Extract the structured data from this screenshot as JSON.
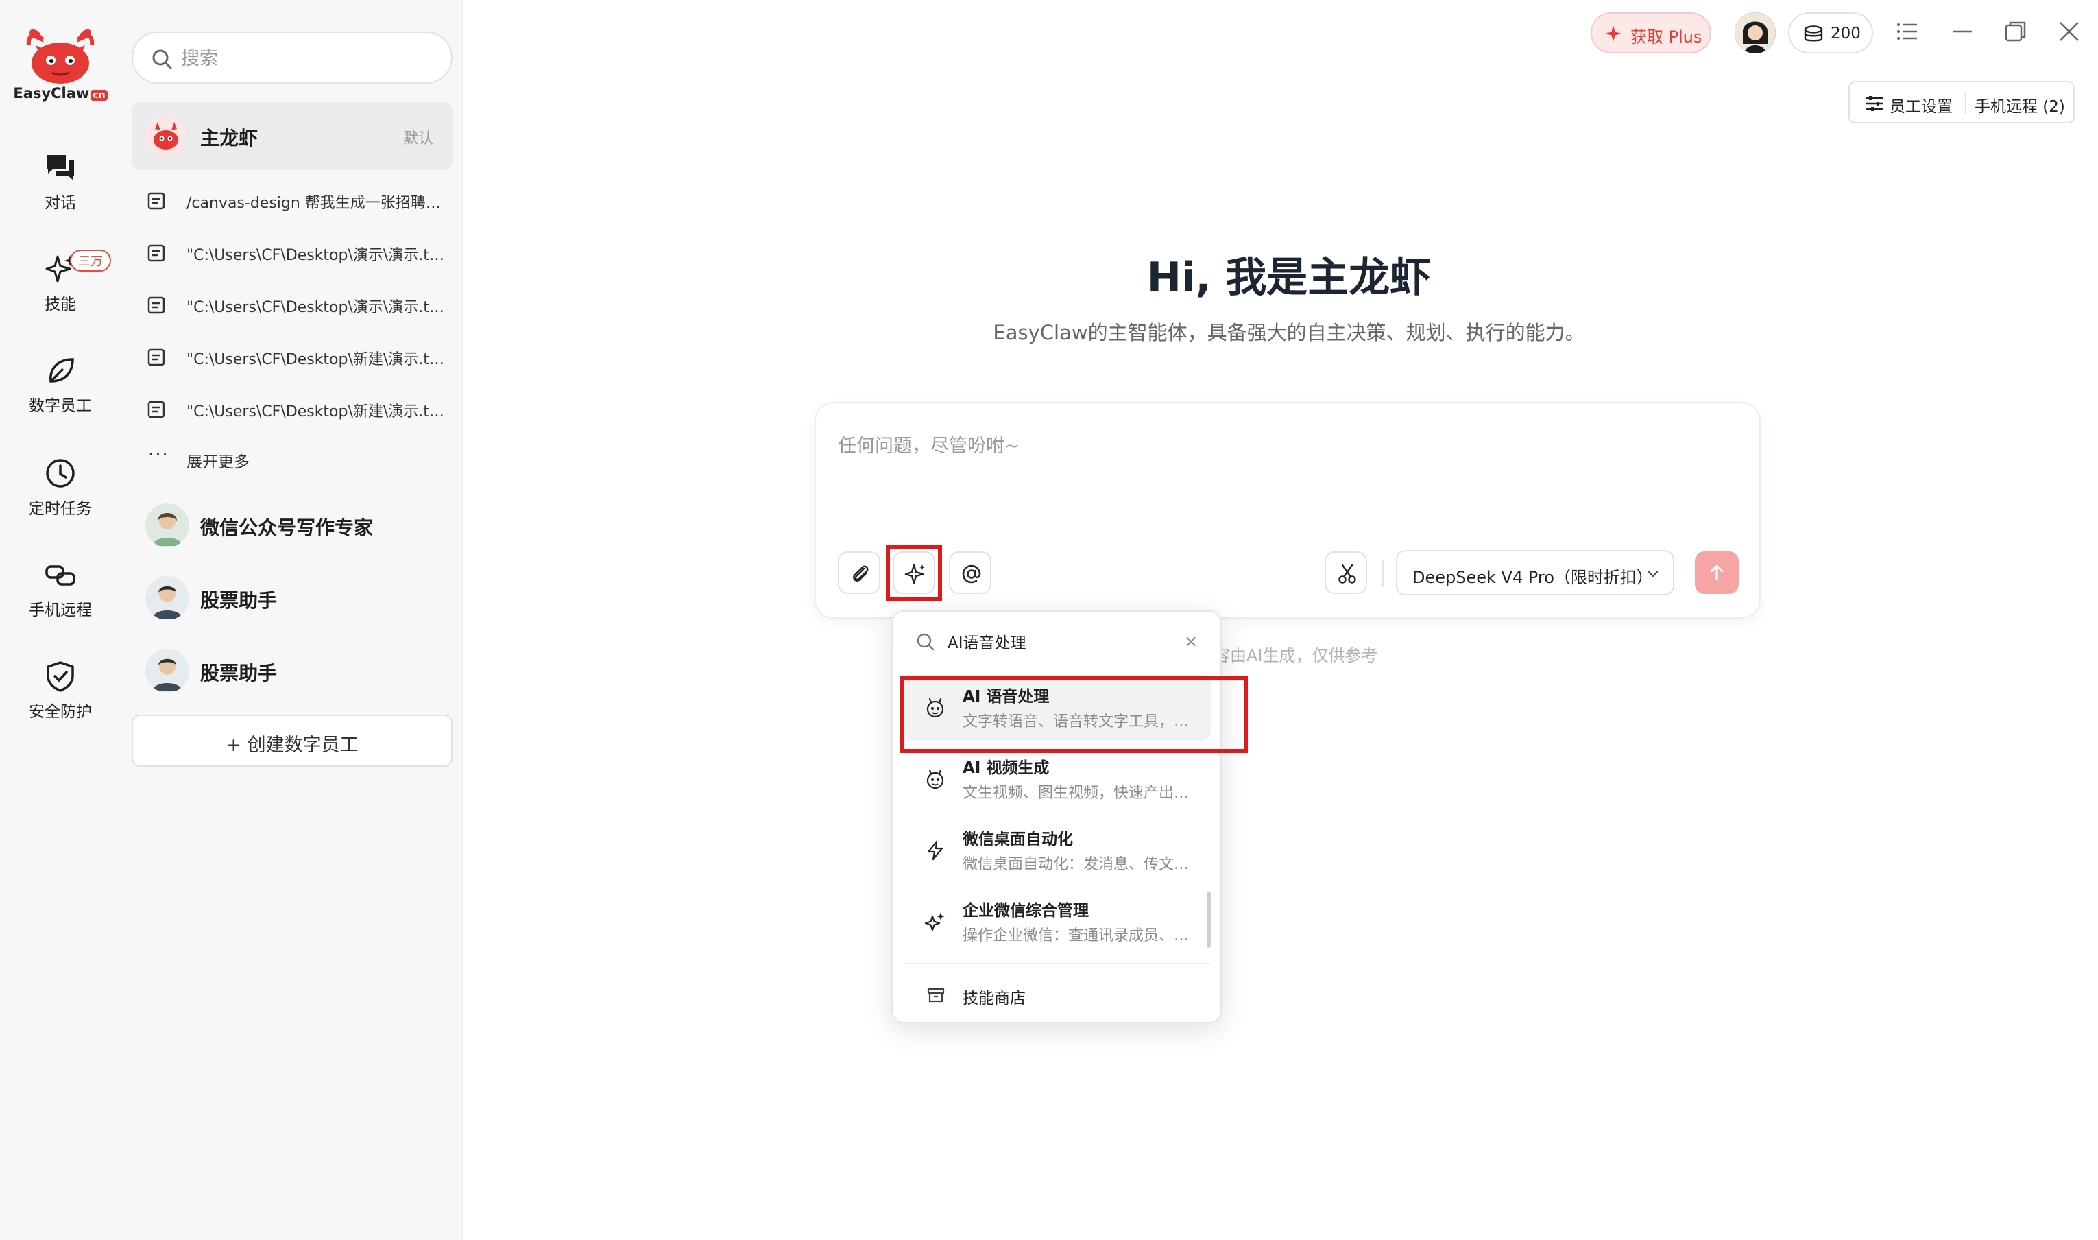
{
  "app": {
    "logo_text": "EasyClaw",
    "logo_badge": "cn"
  },
  "colors": {
    "accent": "#e53935",
    "highlight_box": "#e0191b",
    "send_button": "#f7a4a4",
    "plus_bg": "#fde8e8"
  },
  "rail": {
    "items": [
      {
        "label": "对话",
        "icon": "chat-icon"
      },
      {
        "label": "技能",
        "icon": "sparkle-icon",
        "badge": "三万"
      },
      {
        "label": "数字员工",
        "icon": "leaf-icon"
      },
      {
        "label": "定时任务",
        "icon": "clock-icon"
      },
      {
        "label": "手机远程",
        "icon": "link-icon"
      },
      {
        "label": "安全防护",
        "icon": "shield-check-icon"
      }
    ]
  },
  "sidebar": {
    "search_placeholder": "搜索",
    "main_agent": {
      "name": "主龙虾",
      "tag": "默认"
    },
    "conversations": [
      "/canvas-design 帮我生成一张招聘海报",
      "\"C:\\Users\\CF\\Desktop\\演示\\演示.txt\"",
      "\"C:\\Users\\CF\\Desktop\\演示\\演示.txt\"",
      "\"C:\\Users\\CF\\Desktop\\新建\\演示.txt\"",
      "\"C:\\Users\\CF\\Desktop\\新建\\演示.txt\""
    ],
    "more_label": "展开更多",
    "agents": [
      {
        "name": "微信公众号写作专家"
      },
      {
        "name": "股票助手"
      },
      {
        "name": "股票助手"
      }
    ],
    "create_label": "+ 创建数字员工"
  },
  "topbar": {
    "plus_label": "获取 Plus",
    "credits": "200",
    "employee_settings": "员工设置",
    "phone_remote": "手机远程 (2)"
  },
  "hero": {
    "title": "Hi, 我是主龙虾",
    "subtitle": "EasyClaw的主智能体，具备强大的自主决策、规划、执行的能力。"
  },
  "composer": {
    "placeholder": "任何问题，尽管吩咐~",
    "model": "DeepSeek V4 Pro（限时折扣）"
  },
  "disclaimer": "容由AI生成，仅供参考",
  "skills_dropdown": {
    "search_value": "AI语音处理",
    "items": [
      {
        "title": "AI 语音处理",
        "desc": "文字转语音、语音转文字工具，支持多种音色",
        "icon": "robot-icon"
      },
      {
        "title": "AI 视频生成",
        "desc": "文生视频、图生视频，快速产出短视频内容",
        "icon": "robot-icon"
      },
      {
        "title": "微信桌面自动化",
        "desc": "微信桌面自动化：发消息、传文件、读取聊天",
        "icon": "lightning-icon"
      },
      {
        "title": "企业微信综合管理",
        "desc": "操作企业微信：查通讯录成员、发送消息",
        "icon": "sparkles-icon"
      }
    ],
    "store_label": "技能商店"
  }
}
